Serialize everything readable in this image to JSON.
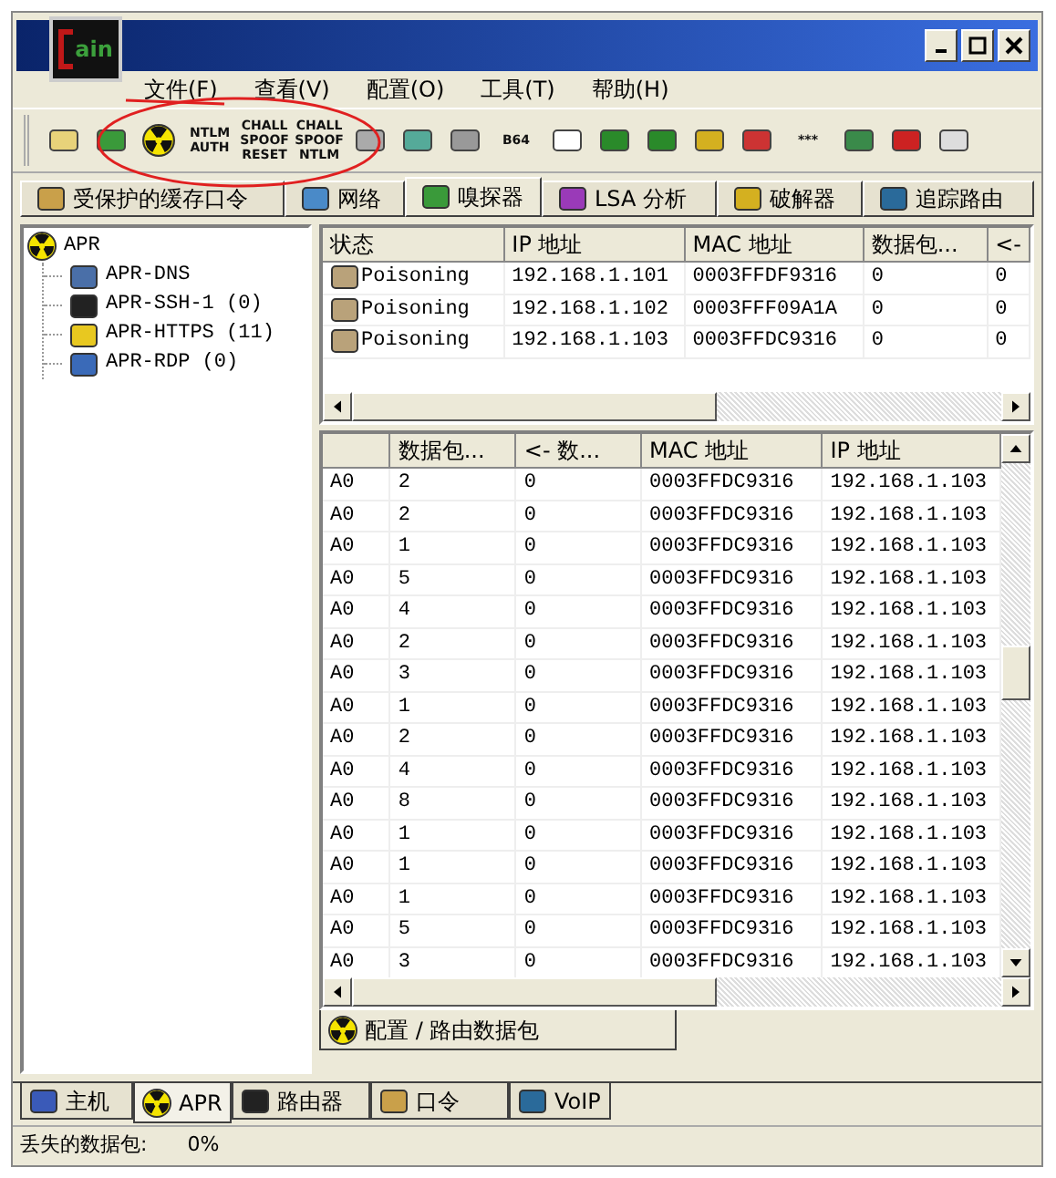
{
  "window": {
    "logo_text": "ain"
  },
  "menu": [
    "文件(F)",
    "查看(V)",
    "配置(O)",
    "工具(T)",
    "帮助(H)"
  ],
  "toolbar": [
    {
      "kind": "icon"
    },
    {
      "kind": "icon"
    },
    {
      "kind": "icon"
    },
    {
      "kind": "text",
      "label": "NTLM AUTH"
    },
    {
      "kind": "text",
      "label": "CHALL SPOOF RESET"
    },
    {
      "kind": "text",
      "label": "CHALL SPOOF NTLM"
    },
    {
      "kind": "icon"
    },
    {
      "kind": "icon"
    },
    {
      "kind": "icon"
    },
    {
      "kind": "text",
      "label": "B64"
    },
    {
      "kind": "icon"
    },
    {
      "kind": "icon"
    },
    {
      "kind": "icon"
    },
    {
      "kind": "icon"
    },
    {
      "kind": "icon"
    },
    {
      "kind": "text",
      "label": "***"
    },
    {
      "kind": "icon"
    },
    {
      "kind": "icon"
    },
    {
      "kind": "icon"
    }
  ],
  "tabs": [
    {
      "label": "受保护的缓存口令",
      "selected": false
    },
    {
      "label": "网络",
      "selected": false
    },
    {
      "label": "嗅探器",
      "selected": true
    },
    {
      "label": "LSA 分析",
      "selected": false
    },
    {
      "label": "破解器",
      "selected": false
    },
    {
      "label": "追踪路由",
      "selected": false
    }
  ],
  "tree": {
    "label": "APR",
    "children": [
      {
        "label": "APR-DNS"
      },
      {
        "label": "APR-SSH-1 (0)"
      },
      {
        "label": "APR-HTTPS (11)"
      },
      {
        "label": "APR-RDP (0)"
      }
    ]
  },
  "top_table": {
    "columns": [
      "状态",
      "IP 地址",
      "MAC 地址",
      "数据包...",
      "<-"
    ],
    "rows": [
      [
        "Poisoning",
        "192.168.1.101",
        "0003FFDF9316",
        "0",
        "0"
      ],
      [
        "Poisoning",
        "192.168.1.102",
        "0003FFF09A1A",
        "0",
        "0"
      ],
      [
        "Poisoning",
        "192.168.1.103",
        "0003FFDC9316",
        "0",
        "0"
      ]
    ]
  },
  "bottom_table": {
    "columns": [
      "",
      "数据包...",
      "<- 数...",
      "MAC 地址",
      "IP 地址"
    ],
    "rows": [
      [
        "A0",
        "2",
        "0",
        "0003FFDC9316",
        "192.168.1.103"
      ],
      [
        "A0",
        "2",
        "0",
        "0003FFDC9316",
        "192.168.1.103"
      ],
      [
        "A0",
        "1",
        "0",
        "0003FFDC9316",
        "192.168.1.103"
      ],
      [
        "A0",
        "5",
        "0",
        "0003FFDC9316",
        "192.168.1.103"
      ],
      [
        "A0",
        "4",
        "0",
        "0003FFDC9316",
        "192.168.1.103"
      ],
      [
        "A0",
        "2",
        "0",
        "0003FFDC9316",
        "192.168.1.103"
      ],
      [
        "A0",
        "3",
        "0",
        "0003FFDC9316",
        "192.168.1.103"
      ],
      [
        "A0",
        "1",
        "0",
        "0003FFDC9316",
        "192.168.1.103"
      ],
      [
        "A0",
        "2",
        "0",
        "0003FFDC9316",
        "192.168.1.103"
      ],
      [
        "A0",
        "4",
        "0",
        "0003FFDC9316",
        "192.168.1.103"
      ],
      [
        "A0",
        "8",
        "0",
        "0003FFDC9316",
        "192.168.1.103"
      ],
      [
        "A0",
        "1",
        "0",
        "0003FFDC9316",
        "192.168.1.103"
      ],
      [
        "A0",
        "1",
        "0",
        "0003FFDC9316",
        "192.168.1.103"
      ],
      [
        "A0",
        "1",
        "0",
        "0003FFDC9316",
        "192.168.1.103"
      ],
      [
        "A0",
        "5",
        "0",
        "0003FFDC9316",
        "192.168.1.103"
      ],
      [
        "A0",
        "3",
        "0",
        "0003FFDC9316",
        "192.168.1.103"
      ]
    ]
  },
  "sub_tab": {
    "label": "配置 / 路由数据包",
    "selected": true
  },
  "bottom_tabs": [
    {
      "label": "主机",
      "selected": false
    },
    {
      "label": "APR",
      "selected": true
    },
    {
      "label": "路由器",
      "selected": false
    },
    {
      "label": "口令",
      "selected": false
    },
    {
      "label": "VoIP",
      "selected": false
    }
  ],
  "status_bar": {
    "label": "丢失的数据包:",
    "value": "0%"
  }
}
